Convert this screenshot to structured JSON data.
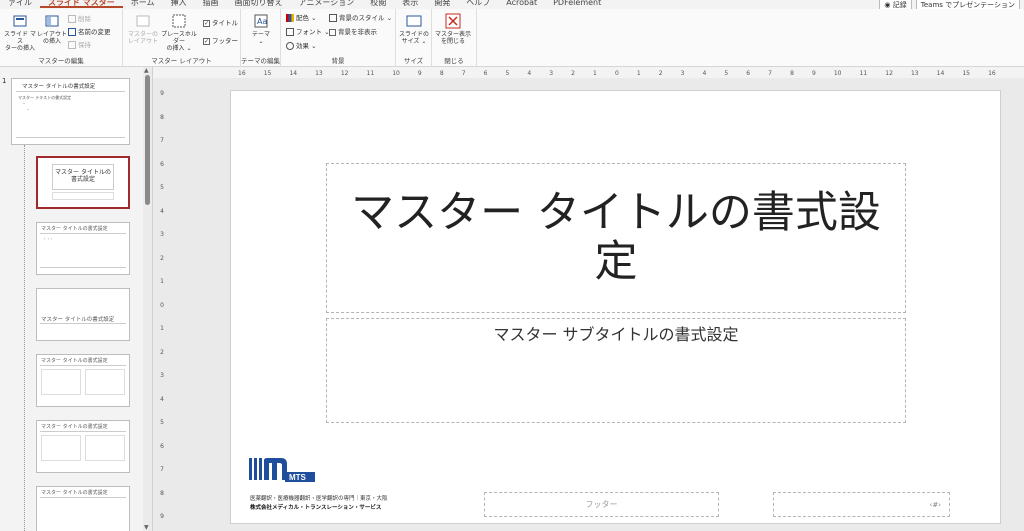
{
  "tabs": {
    "items": [
      "ァイル",
      "スライド マスター",
      "ホーム",
      "挿入",
      "描画",
      "画面切り替え",
      "アニメーション",
      "校閲",
      "表示",
      "開発",
      "ヘルプ",
      "Acrobat",
      "PDFelement"
    ],
    "active_index": 1,
    "record_label": "記録",
    "teams_label": "Teams でプレゼンテーション"
  },
  "ribbon": {
    "master_edit": {
      "insert_master": "スライド マス\nターの挿入",
      "insert_layout": "レイアウト\nの挿入",
      "delete": "削除",
      "rename": "名前の変更",
      "preserve": "保持",
      "group_label": "マスターの編集"
    },
    "master_layout": {
      "master_layout_btn": "マスターの\nレイアウト",
      "insert_placeholder": "プレースホルダー\nの挿入 ⌄",
      "title_cb": "タイトル",
      "footer_cb": "フッター",
      "group_label": "マスター レイアウト"
    },
    "theme_edit": {
      "theme_btn": "テーマ\n⌄",
      "group_label": "テーマの編集"
    },
    "background": {
      "colors": "配色 ⌄",
      "fonts": "フォント ⌄",
      "effects": "効果 ⌄",
      "bg_styles": "背景のスタイル ⌄",
      "hide_bg": "背景を非表示",
      "group_label": "背景"
    },
    "size": {
      "slide_size": "スライドの\nサイズ ⌄",
      "group_label": "サイズ"
    },
    "close": {
      "close_master": "マスター表示\nを閉じる",
      "group_label": "閉じる"
    }
  },
  "left_pane": {
    "slide_number": "1",
    "master_thumb_title": "マスター タイトルの書式設定",
    "master_thumb_body": "マスター テキストの書式設定",
    "selected_thumb_title": "マスター タイトルの書式設定",
    "thumb2_title": "マスター タイトルの書式設定",
    "thumb3_title": "マスター タイトルの書式設定",
    "thumb4_title": "マスター タイトルの書式設定",
    "thumb5_title": "マスター タイトルの書式設定",
    "thumb6_title": "マスター タイトルの書式設定"
  },
  "rulers": {
    "h_ticks": [
      "16",
      "15",
      "14",
      "13",
      "12",
      "11",
      "10",
      "9",
      "8",
      "7",
      "6",
      "5",
      "4",
      "3",
      "2",
      "1",
      "0",
      "1",
      "2",
      "3",
      "4",
      "5",
      "6",
      "7",
      "8",
      "9",
      "10",
      "11",
      "12",
      "13",
      "14",
      "15",
      "16"
    ],
    "v_ticks": [
      "9",
      "8",
      "7",
      "6",
      "5",
      "4",
      "3",
      "2",
      "1",
      "0",
      "1",
      "2",
      "3",
      "4",
      "5",
      "6",
      "7",
      "8",
      "9"
    ]
  },
  "slide": {
    "title": "マスター タイトルの書式設定",
    "subtitle": "マスター サブタイトルの書式設定",
    "footer": "フッター",
    "page_number": "‹#›",
    "logo_text": "MTS",
    "company_line1": "医薬翻訳・医療機器翻訳・医学翻訳の専門｜東京・大阪",
    "company_line2": "株式会社メディカル・トランスレーション・サービス"
  },
  "colors": {
    "accent": "#b7472a",
    "selected_border": "#9e2a2b",
    "logo_blue": "#1f4e9c"
  }
}
